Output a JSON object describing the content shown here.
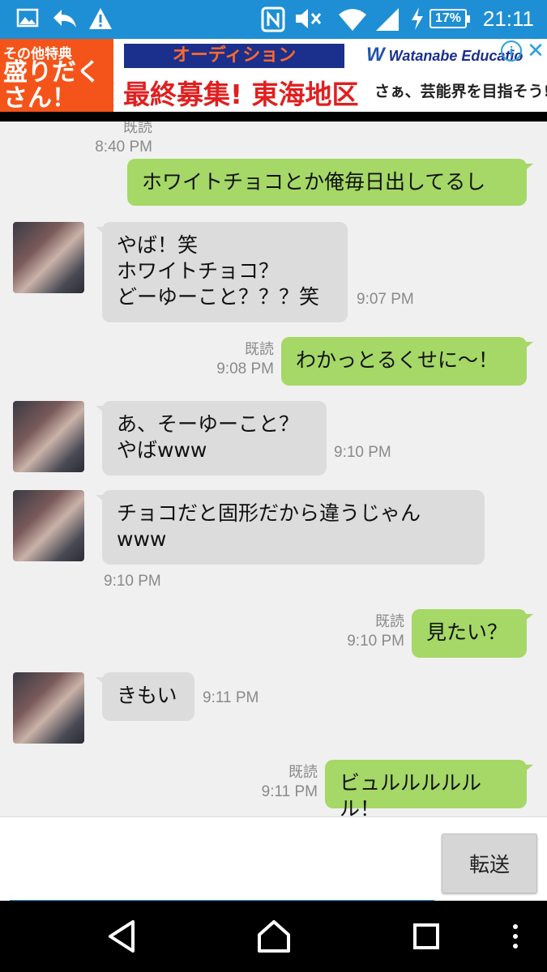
{
  "status_bar": {
    "time": "21:11",
    "battery": "17%",
    "icons": [
      "image-icon",
      "reply-icon",
      "warning-icon",
      "nfc-icon",
      "mute-icon",
      "wifi-icon",
      "signal-icon",
      "charging-icon"
    ]
  },
  "ad": {
    "left_line1": "その他特典",
    "left_line2": "盛りだく\nさん！",
    "audition": "オーディション",
    "brand": "Watanabe Educatio",
    "headline": "最終募集! 東海地区",
    "sub": "さぁ、芸能界を目指そう!"
  },
  "messages": [
    {
      "from": "me",
      "read": "既読",
      "time": "8:40 PM",
      "text": "ホワイトチョコとか俺毎日出してるし"
    },
    {
      "from": "you",
      "time": "9:07 PM",
      "text": "やば！笑\nホワイトチョコ？\nどーゆーこと？？？笑"
    },
    {
      "from": "me",
      "read": "既読",
      "time": "9:08 PM",
      "text": "わかっとるくせに〜！"
    },
    {
      "from": "you",
      "time": "9:10 PM",
      "text": "あ、そーゆーこと？\nやばwww"
    },
    {
      "from": "you",
      "time": "9:10 PM",
      "text": "チョコだと固形だから違うじゃん\nwww"
    },
    {
      "from": "me",
      "read": "既読",
      "time": "9:10 PM",
      "text": "見たい？"
    },
    {
      "from": "you",
      "time": "9:11 PM",
      "text": "きもい"
    },
    {
      "from": "me",
      "read": "既読",
      "time": "9:11 PM",
      "text": "ビュルルルルルル！"
    }
  ],
  "input": {
    "placeholder": "",
    "value": ""
  },
  "send_label": "転送",
  "colors": {
    "status_bar": "#1e8fd4",
    "my_bubble": "#a5d867",
    "their_bubble": "#dcdcdc",
    "background": "#f0f0f0",
    "input_underline": "#2a9fd6"
  }
}
